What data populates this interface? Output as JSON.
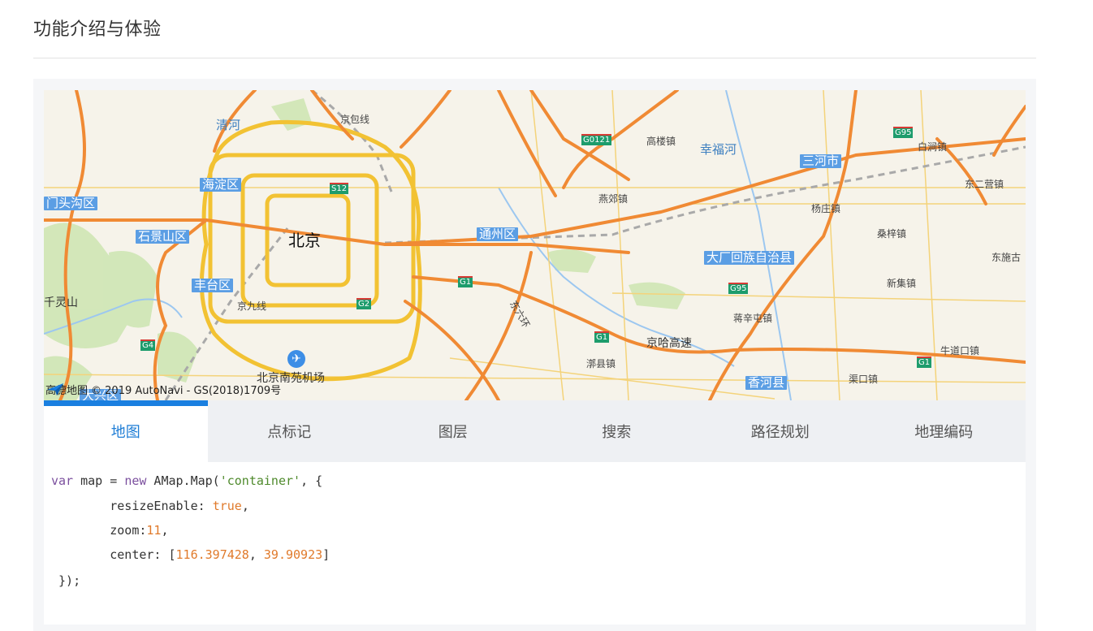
{
  "section": {
    "title": "功能介绍与体验"
  },
  "map": {
    "labels": {
      "qinghe": "清河",
      "jingbaoxian": "京包线",
      "haidian": "海淀区",
      "mentougou": "门头沟区",
      "shijingshan": "石景山区",
      "beijing": "北京",
      "fengtai": "丰台区",
      "qianlingshan": "千灵山",
      "jingjiuxian": "京九线",
      "nanyuan": "北京南苑机场",
      "tongzhou": "通州区",
      "yanjiao": "燕郊镇",
      "gaolou": "高楼镇",
      "xingfuhe": "幸福河",
      "sanhe": "三河市",
      "baixun": "白涧镇",
      "dongerying": "东二营镇",
      "yangzhuang": "杨庄镇",
      "sangzi": "桑梓镇",
      "dachang": "大厂回族自治县",
      "dongshigu": "东施古",
      "xinji": "新集镇",
      "dongliuhuan": "东六环",
      "jiangxintun": "蒋辛屯镇",
      "jinghagaosu": "京哈高速",
      "lixian": "漷县镇",
      "niudaokou": "牛道口镇",
      "xianghe": "香河县",
      "quzhen": "渠口镇",
      "daxing": "大兴区"
    },
    "badges": {
      "g0121": "G0121",
      "s12": "S12",
      "g1a": "G1",
      "g1b": "G1",
      "g1c": "G1",
      "g2": "G2",
      "g4": "G4",
      "g95a": "G95",
      "g95b": "G95"
    },
    "attribution": {
      "brand": "高德地图",
      "copyright": "© 2019 AutoNavi - GS(2018)1709号"
    }
  },
  "tabs": [
    {
      "label": "地图",
      "active": true
    },
    {
      "label": "点标记",
      "active": false
    },
    {
      "label": "图层",
      "active": false
    },
    {
      "label": "搜索",
      "active": false
    },
    {
      "label": "路径规划",
      "active": false
    },
    {
      "label": "地理编码",
      "active": false
    }
  ],
  "code": {
    "var_kw": "var",
    "line1_mid": " map = ",
    "new_kw": "new",
    "line1_call": " AMap.Map(",
    "container_str": "'container'",
    "line1_end": ", {",
    "resize_key": "        resizeEnable: ",
    "resize_val": "true",
    "resize_end": ",",
    "zoom_key": "        zoom:",
    "zoom_val": "11",
    "zoom_end": ",",
    "center_key": "        center: [",
    "center_lng": "116.397428",
    "center_sep": ", ",
    "center_lat": "39.90923",
    "center_end": "]",
    "close": " });"
  },
  "colors": {
    "accent": "#1a7fe0",
    "highway": "#f08a34",
    "ring_road": "#f2c233",
    "district_bg": "#5b9ee4"
  }
}
